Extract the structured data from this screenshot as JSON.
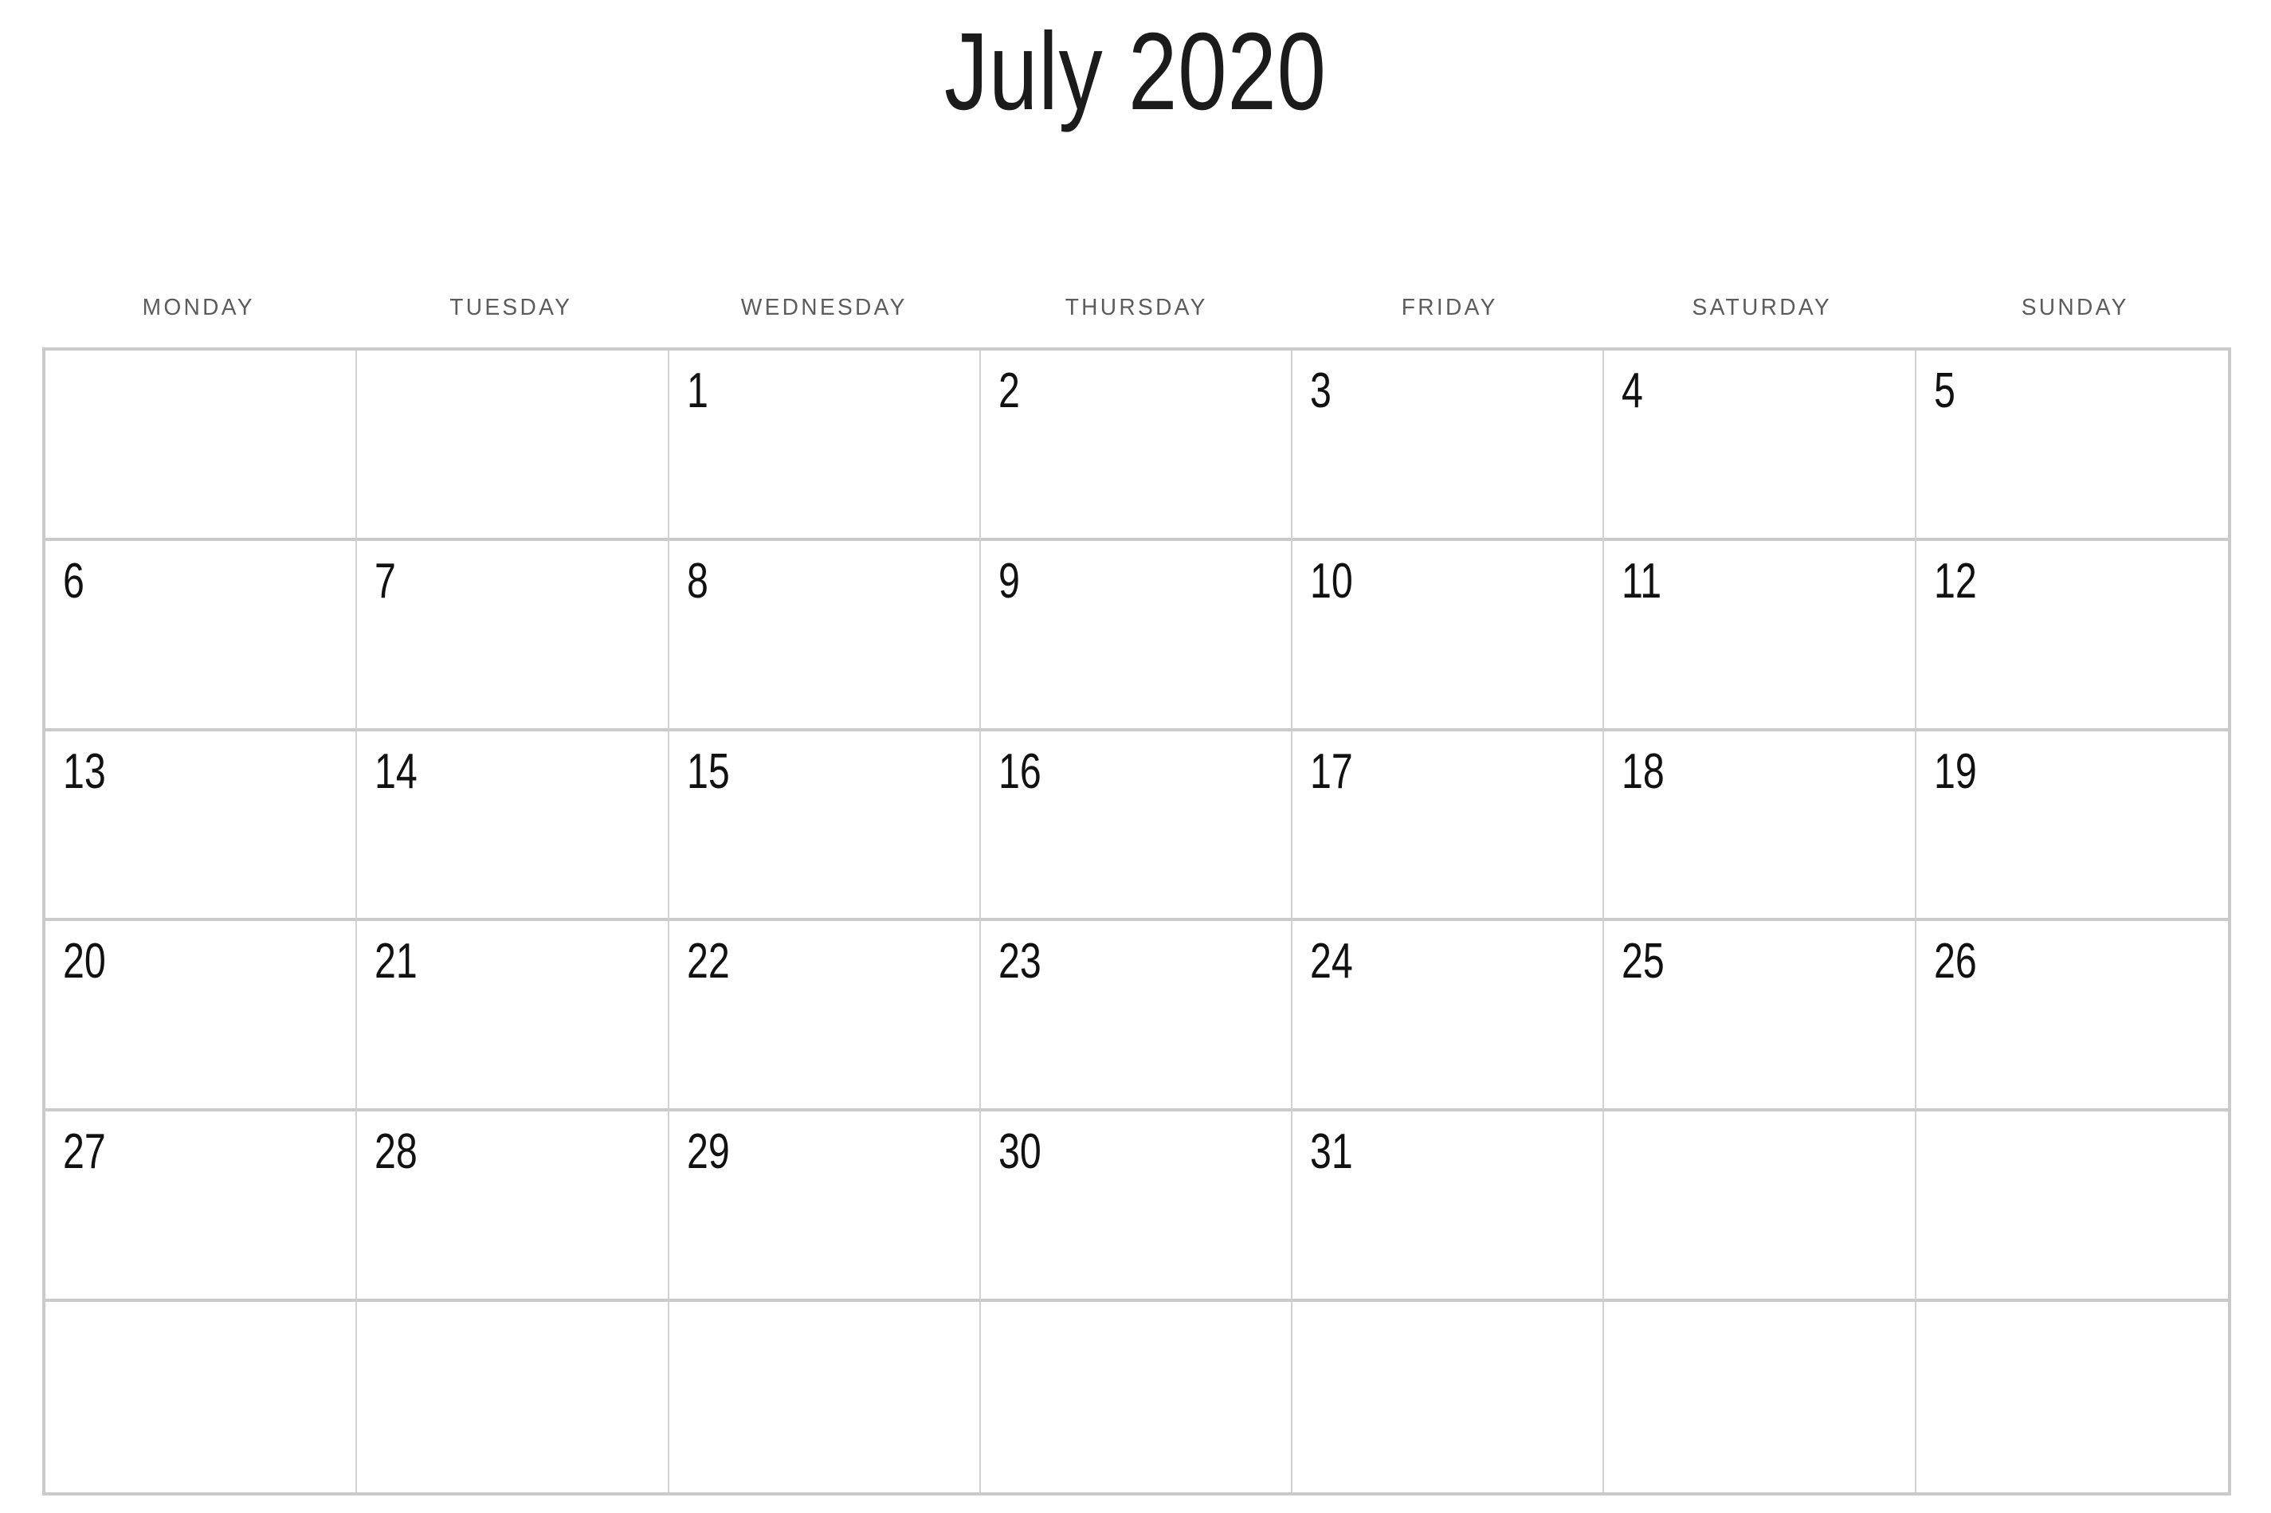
{
  "header": {
    "month_title": "July 2020"
  },
  "weekdays": [
    {
      "label": "MONDAY"
    },
    {
      "label": "TUESDAY"
    },
    {
      "label": "WEDNESDAY"
    },
    {
      "label": "THURSDAY"
    },
    {
      "label": "FRIDAY"
    },
    {
      "label": "SATURDAY"
    },
    {
      "label": "SUNDAY"
    }
  ],
  "colors": {
    "background": "#ffffff",
    "title_text": "#1b1b1b",
    "weekday_text": "#5c5c5c",
    "grid_border": "#cacaca",
    "cell_divider": "#d2d2d2",
    "day_number_text": "#111111"
  },
  "grid": {
    "columns": 7,
    "rows": 6,
    "weeks": [
      {
        "days": [
          "",
          "",
          "1",
          "2",
          "3",
          "4",
          "5"
        ]
      },
      {
        "days": [
          "6",
          "7",
          "8",
          "9",
          "10",
          "11",
          "12"
        ]
      },
      {
        "days": [
          "13",
          "14",
          "15",
          "16",
          "17",
          "18",
          "19"
        ]
      },
      {
        "days": [
          "20",
          "21",
          "22",
          "23",
          "24",
          "25",
          "26"
        ]
      },
      {
        "days": [
          "27",
          "28",
          "29",
          "30",
          "31",
          "",
          ""
        ]
      },
      {
        "days": [
          "",
          "",
          "",
          "",
          "",
          "",
          ""
        ]
      }
    ]
  }
}
